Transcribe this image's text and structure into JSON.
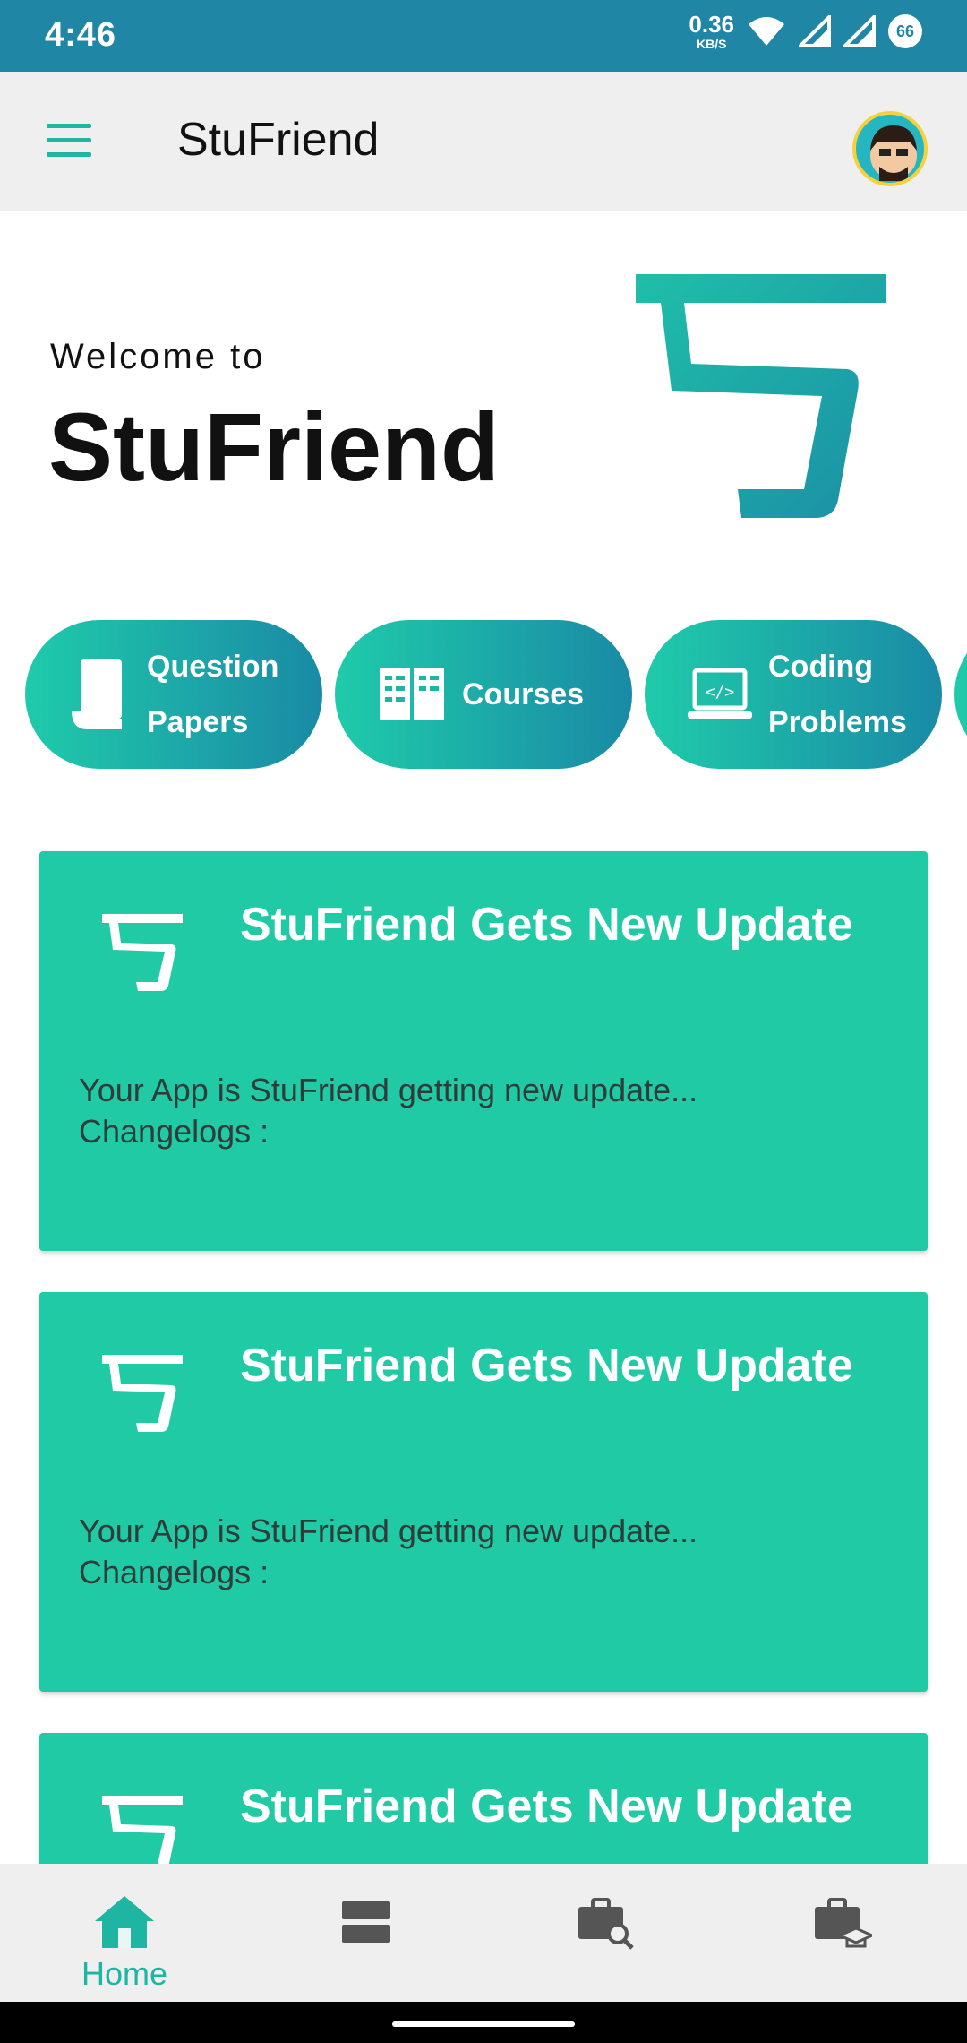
{
  "status_bar": {
    "time": "4:46",
    "net_speed_value": "0.36",
    "net_speed_unit": "KB/S",
    "battery": "66"
  },
  "app_bar": {
    "title": "StuFriend",
    "menu_icon": "hamburger-menu-icon",
    "avatar_icon": "user-avatar"
  },
  "hero": {
    "welcome_small": "Welcome to",
    "welcome_big": "StuFriend",
    "logo_icon": "stufriend-logo"
  },
  "categories": [
    {
      "line1": "Question",
      "line2": "Papers",
      "icon": "scroll-paper-icon"
    },
    {
      "line1": "Courses",
      "line2": "",
      "icon": "book-icon"
    },
    {
      "line1": "Coding",
      "line2": "Problems",
      "icon": "laptop-code-icon"
    }
  ],
  "cards": [
    {
      "title": "StuFriend Gets New Update",
      "body_line1": "Your App is StuFriend getting new update...",
      "body_line2": "Changelogs :"
    },
    {
      "title": "StuFriend Gets New Update",
      "body_line1": "Your App is StuFriend getting new update...",
      "body_line2": "Changelogs :"
    },
    {
      "title": "StuFriend Gets New Update",
      "body_line1": "",
      "body_line2": ""
    }
  ],
  "bottom_nav": [
    {
      "label": "Home",
      "icon": "home-icon",
      "active": true
    },
    {
      "label": "",
      "icon": "stack-icon",
      "active": false
    },
    {
      "label": "",
      "icon": "briefcase-search-icon",
      "active": false
    },
    {
      "label": "",
      "icon": "briefcase-graduation-icon",
      "active": false
    }
  ],
  "colors": {
    "status_bar": "#1f86a6",
    "accent": "#1fb5a3",
    "card": "#1fcaa4",
    "chip_start": "#1fcbaa",
    "chip_end": "#1a8aa6"
  }
}
